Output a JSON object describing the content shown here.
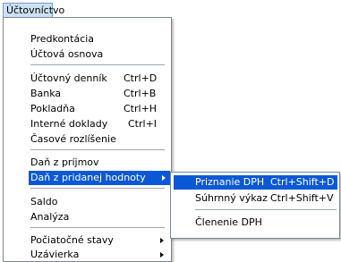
{
  "menubar": {
    "title": "Účtovníctvo"
  },
  "main_menu": {
    "items": [
      {
        "label": "Predkontácia"
      },
      {
        "label": "Účtová osnova"
      },
      {
        "label": "Účtovný denník",
        "shortcut": "Ctrl+D"
      },
      {
        "label": "Banka",
        "shortcut": "Ctrl+B"
      },
      {
        "label": "Pokladňa",
        "shortcut": "Ctrl+H"
      },
      {
        "label": "Interné doklady",
        "shortcut": "Ctrl+I"
      },
      {
        "label": "Časové rozlíšenie"
      },
      {
        "label": "Daň z príjmov"
      },
      {
        "label": "Daň z pridanej hodnoty",
        "has_submenu": true,
        "highlighted": true
      },
      {
        "label": "Saldo"
      },
      {
        "label": "Analýza"
      },
      {
        "label": "Počiatočné stavy",
        "has_submenu": true
      },
      {
        "label": "Uzávierka",
        "has_submenu": true
      }
    ]
  },
  "sub_menu": {
    "items": [
      {
        "label": "Priznanie DPH",
        "shortcut": "Ctrl+Shift+D",
        "highlighted": true
      },
      {
        "label": "Súhrnný výkaz",
        "shortcut": "Ctrl+Shift+V"
      },
      {
        "label": "Členenie DPH"
      }
    ]
  },
  "colors": {
    "highlight": "#0a58d6",
    "menubar_active": "#cde0f5"
  }
}
